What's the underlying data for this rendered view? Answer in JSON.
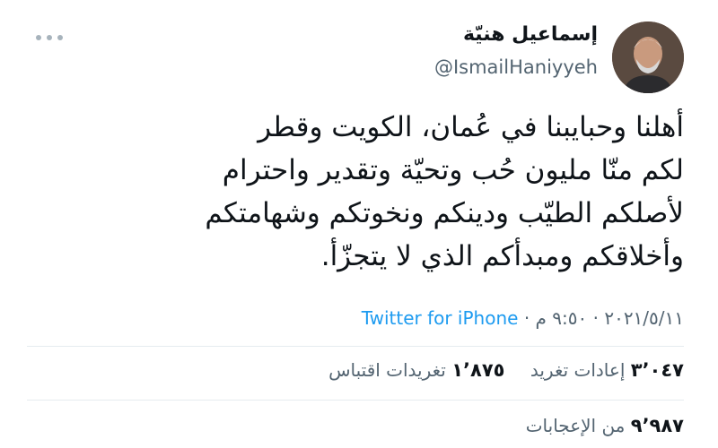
{
  "author": {
    "display_name": "إسماعيل هنيّة",
    "handle": "@IsmailHaniyyeh"
  },
  "tweet": {
    "lines": [
      "أهلنا وحبايبنا في عُمان، الكويت وقطر",
      "لكم منّا مليون حُب وتحيّة وتقدير واحترام",
      "لأصلكم الطيّب ودينكم ونخوتكم وشهامتكم",
      "وأخلاقكم ومبدأكم الذي لا يتجزّأ."
    ],
    "date": "٢٠٢١/٥/١١",
    "time": "٩:٥٠ م",
    "separator": "·",
    "source": "Twitter for iPhone"
  },
  "stats": {
    "retweets": {
      "count": "٣٬٠٤٧",
      "label": "إعادات تغريد"
    },
    "quotes": {
      "count": "١٬٨٧٥",
      "label": "تغريدات اقتباس"
    },
    "likes": {
      "count": "٩٬٩٨٧",
      "label": "من الإعجابات"
    }
  },
  "colors": {
    "link": "#1d9bf0",
    "secondary_text": "#536471",
    "primary_text": "#0f1419"
  },
  "icons": {
    "more": "more-options-icon"
  }
}
